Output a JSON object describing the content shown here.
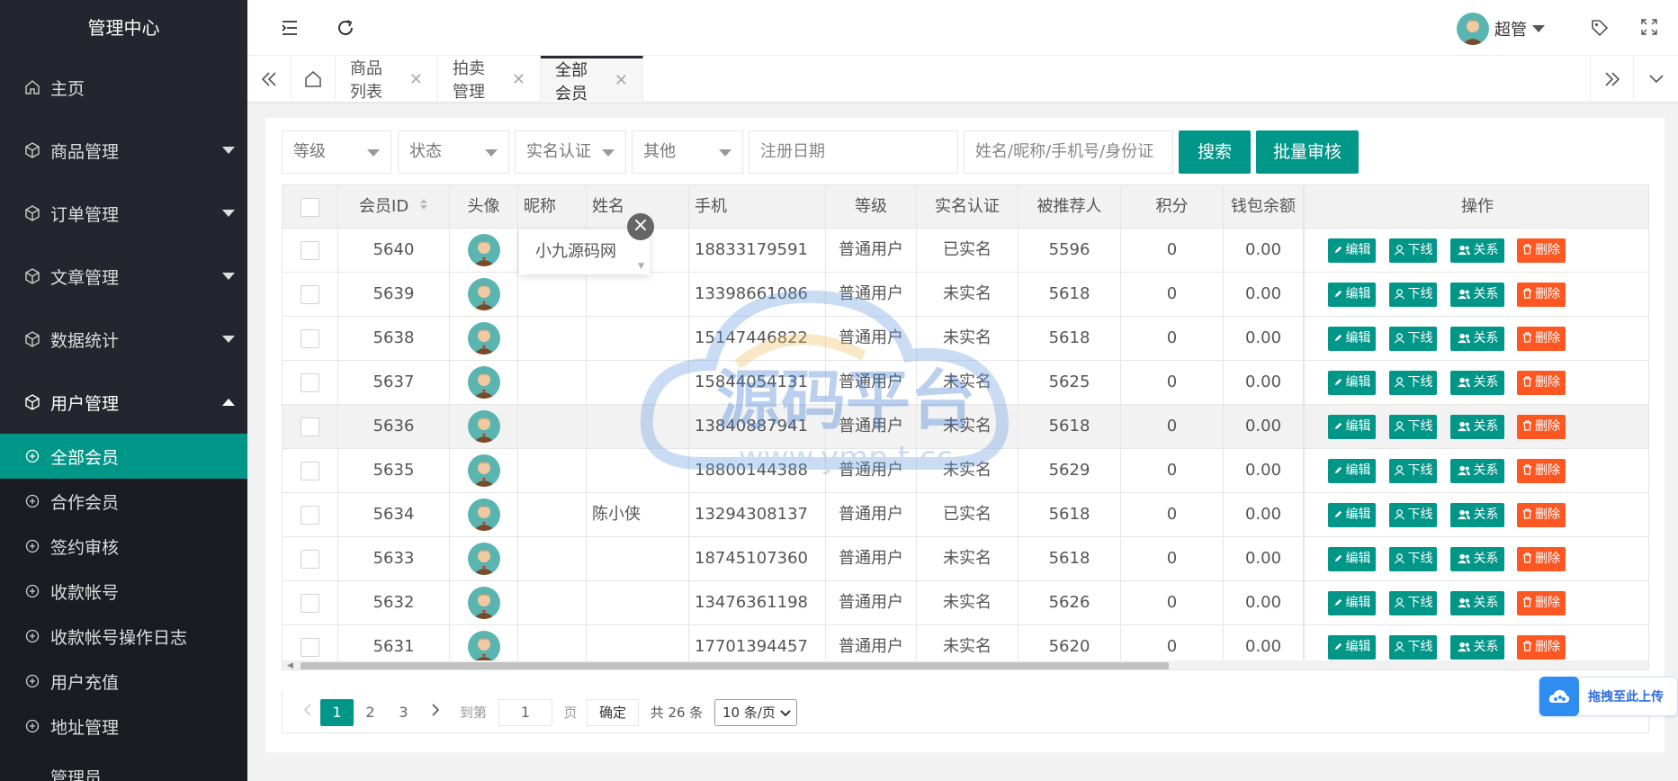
{
  "sidebar": {
    "title": "管理中心",
    "items": [
      {
        "label": "主页",
        "icon": "home-icon"
      },
      {
        "label": "商品管理",
        "icon": "cube-icon"
      },
      {
        "label": "订单管理",
        "icon": "cube-icon"
      },
      {
        "label": "文章管理",
        "icon": "cube-icon"
      },
      {
        "label": "数据统计",
        "icon": "cube-icon"
      },
      {
        "label": "用户管理",
        "icon": "cube-icon"
      }
    ],
    "subitems": [
      {
        "label": "全部会员"
      },
      {
        "label": "合作会员"
      },
      {
        "label": "签约审核"
      },
      {
        "label": "收款帐号"
      },
      {
        "label": "收款帐号操作日志"
      },
      {
        "label": "用户充值"
      },
      {
        "label": "地址管理"
      }
    ],
    "partial_item": "管理员"
  },
  "header": {
    "user_name": "超管"
  },
  "tabs": [
    {
      "label": "商品列表"
    },
    {
      "label": "拍卖管理"
    },
    {
      "label": "全部会员"
    }
  ],
  "filters": {
    "level": "等级",
    "status": "状态",
    "realname": "实名认证",
    "other": "其他",
    "reg_date_placeholder": "注册日期",
    "keyword_placeholder": "姓名/昵称/手机号/身份证",
    "search_label": "搜索",
    "batch_label": "批量审核"
  },
  "table": {
    "headers": [
      "会员ID",
      "头像",
      "昵称",
      "姓名",
      "手机",
      "等级",
      "实名认证",
      "被推荐人",
      "积分",
      "钱包余额",
      "操作"
    ],
    "rows": [
      {
        "id": "5640",
        "nickname": "",
        "name": "",
        "phone": "18833179591",
        "level": "普通用户",
        "verified": "已实名",
        "referrer": "5596",
        "points": "0",
        "balance": "0.00"
      },
      {
        "id": "5639",
        "nickname": "",
        "name": "",
        "phone": "13398661086",
        "level": "普通用户",
        "verified": "未实名",
        "referrer": "5618",
        "points": "0",
        "balance": "0.00"
      },
      {
        "id": "5638",
        "nickname": "",
        "name": "",
        "phone": "15147446822",
        "level": "普通用户",
        "verified": "未实名",
        "referrer": "5618",
        "points": "0",
        "balance": "0.00"
      },
      {
        "id": "5637",
        "nickname": "",
        "name": "",
        "phone": "15844054131",
        "level": "普通用户",
        "verified": "未实名",
        "referrer": "5625",
        "points": "0",
        "balance": "0.00"
      },
      {
        "id": "5636",
        "nickname": "",
        "name": "",
        "phone": "13840887941",
        "level": "普通用户",
        "verified": "未实名",
        "referrer": "5618",
        "points": "0",
        "balance": "0.00"
      },
      {
        "id": "5635",
        "nickname": "",
        "name": "",
        "phone": "18800144388",
        "level": "普通用户",
        "verified": "未实名",
        "referrer": "5629",
        "points": "0",
        "balance": "0.00"
      },
      {
        "id": "5634",
        "nickname": "",
        "name": "陈小侠",
        "phone": "13294308137",
        "level": "普通用户",
        "verified": "已实名",
        "referrer": "5618",
        "points": "0",
        "balance": "0.00"
      },
      {
        "id": "5633",
        "nickname": "",
        "name": "",
        "phone": "18745107360",
        "level": "普通用户",
        "verified": "未实名",
        "referrer": "5618",
        "points": "0",
        "balance": "0.00"
      },
      {
        "id": "5632",
        "nickname": "",
        "name": "",
        "phone": "13476361198",
        "level": "普通用户",
        "verified": "未实名",
        "referrer": "5626",
        "points": "0",
        "balance": "0.00"
      },
      {
        "id": "5631",
        "nickname": "",
        "name": "",
        "phone": "17701394457",
        "level": "普通用户",
        "verified": "未实名",
        "referrer": "5620",
        "points": "0",
        "balance": "0.00"
      }
    ],
    "actions": {
      "edit": "编辑",
      "offline": "下线",
      "relation": "关系",
      "delete": "删除"
    }
  },
  "tooltip": {
    "text": "小九源码网"
  },
  "pagination": {
    "pages": [
      "1",
      "2",
      "3"
    ],
    "goto_label": "到第",
    "goto_value": "1",
    "page_unit": "页",
    "confirm_label": "确定",
    "total_label": "共 26 条",
    "page_size": "10 条/页"
  },
  "watermark": {
    "text1": "源码平台",
    "text2": "www.ymp t.cc"
  },
  "upload": {
    "label": "拖拽至此上传"
  },
  "colors": {
    "sidebar_bg": "#23262e",
    "accent": "#009688",
    "danger": "#ff5722"
  }
}
